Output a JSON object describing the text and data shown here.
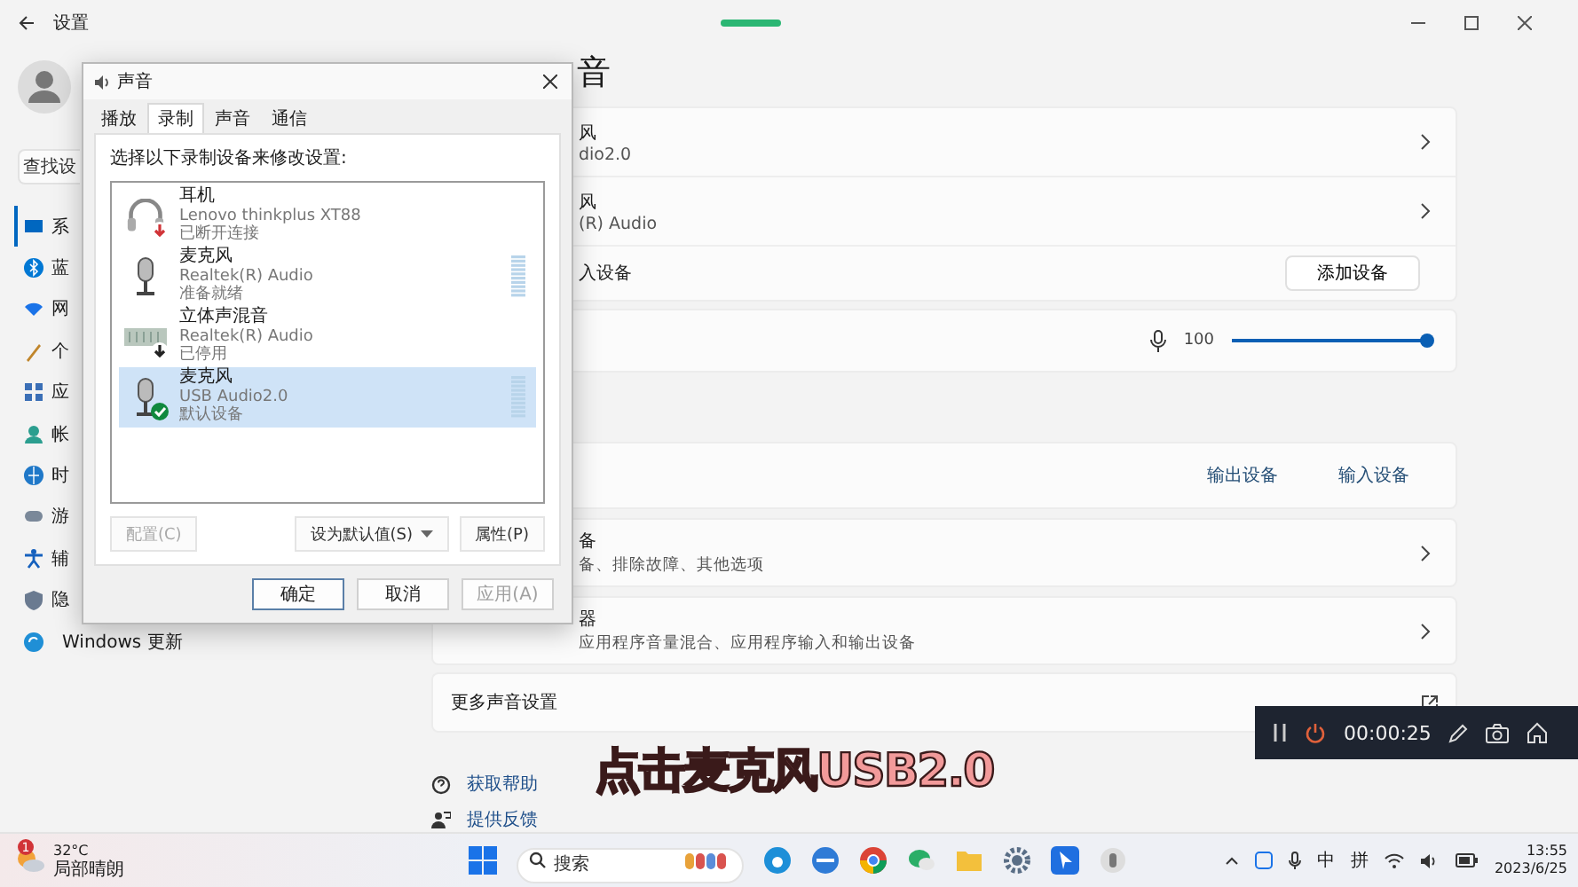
{
  "settings": {
    "title": "设置",
    "search": {
      "placeholder": "查找设"
    },
    "nav": [
      {
        "label": "系",
        "selected": true
      },
      {
        "label": "蓝",
        "selected": false
      },
      {
        "label": "网",
        "selected": false
      },
      {
        "label": "个",
        "selected": false
      },
      {
        "label": "应",
        "selected": false
      },
      {
        "label": "帐",
        "selected": false
      },
      {
        "label": "时",
        "selected": false
      },
      {
        "label": "游",
        "selected": false
      },
      {
        "label": "辅",
        "selected": false
      },
      {
        "label": "隐",
        "selected": false
      },
      {
        "label": "Windows 更新",
        "selected": false
      }
    ]
  },
  "page": {
    "title": "音",
    "input_devices": [
      {
        "name": "风",
        "detail": "dio2.0"
      },
      {
        "name": "风",
        "detail": "(R) Audio"
      }
    ],
    "add_row": {
      "label": "入设备",
      "button": "添加设备"
    },
    "volume": {
      "reading": "100",
      "level": 1
    },
    "links": [
      "输出设备",
      "输入设备"
    ],
    "cards": [
      {
        "title": "备",
        "subtitle": "备、排除故障、其他选项"
      },
      {
        "title": "器",
        "subtitle": "应用程序音量混合、应用程序输入和输出设备"
      }
    ],
    "more": "更多声音设置",
    "help": [
      "获取帮助",
      "提供反馈"
    ]
  },
  "dialog": {
    "title": "声音",
    "tabs": [
      {
        "label": "播放",
        "selected": false
      },
      {
        "label": "录制",
        "selected": true
      },
      {
        "label": "声音",
        "selected": false
      },
      {
        "label": "通信",
        "selected": false
      }
    ],
    "instruction": "选择以下录制设备来修改设置:",
    "devices": [
      {
        "kind": "headset",
        "name": "耳机",
        "driver": "Lenovo thinkplus XT88",
        "status": "已断开连接",
        "disconnected": true,
        "disabled": false,
        "default": false,
        "meter": false,
        "selected": false
      },
      {
        "kind": "mic",
        "name": "麦克风",
        "driver": "Realtek(R) Audio",
        "status": "准备就绪",
        "disconnected": false,
        "disabled": false,
        "default": false,
        "meter": true,
        "selected": false
      },
      {
        "kind": "mixer",
        "name": "立体声混音",
        "driver": "Realtek(R) Audio",
        "status": "已停用",
        "disconnected": false,
        "disabled": true,
        "default": false,
        "meter": false,
        "selected": false
      },
      {
        "kind": "mic",
        "name": "麦克风",
        "driver": "USB Audio2.0",
        "status": "默认设备",
        "disconnected": false,
        "disabled": false,
        "default": true,
        "meter": true,
        "selected": true
      }
    ],
    "list_buttons": [
      {
        "kind": "plain",
        "label": "配置(C)",
        "disabled": true
      },
      {
        "kind": "split",
        "label": "设为默认值(S)",
        "disabled": false
      },
      {
        "kind": "plain",
        "label": "属性(P)",
        "disabled": false
      }
    ],
    "footer_buttons": [
      {
        "label": "确定",
        "default": true,
        "disabled": false
      },
      {
        "label": "取消",
        "default": false,
        "disabled": false
      },
      {
        "label": "应用(A)",
        "default": false,
        "disabled": true
      }
    ]
  },
  "caption": "点击麦克风USB2.0",
  "recorder": {
    "time": "00:00:25"
  },
  "taskbar": {
    "weather": {
      "badge": "1",
      "temp": "32°C",
      "desc": "局部晴朗"
    },
    "search": {
      "placeholder": "搜索"
    },
    "ime": [
      "中",
      "拼"
    ],
    "time": "13:55",
    "date": "2023/6/25"
  }
}
